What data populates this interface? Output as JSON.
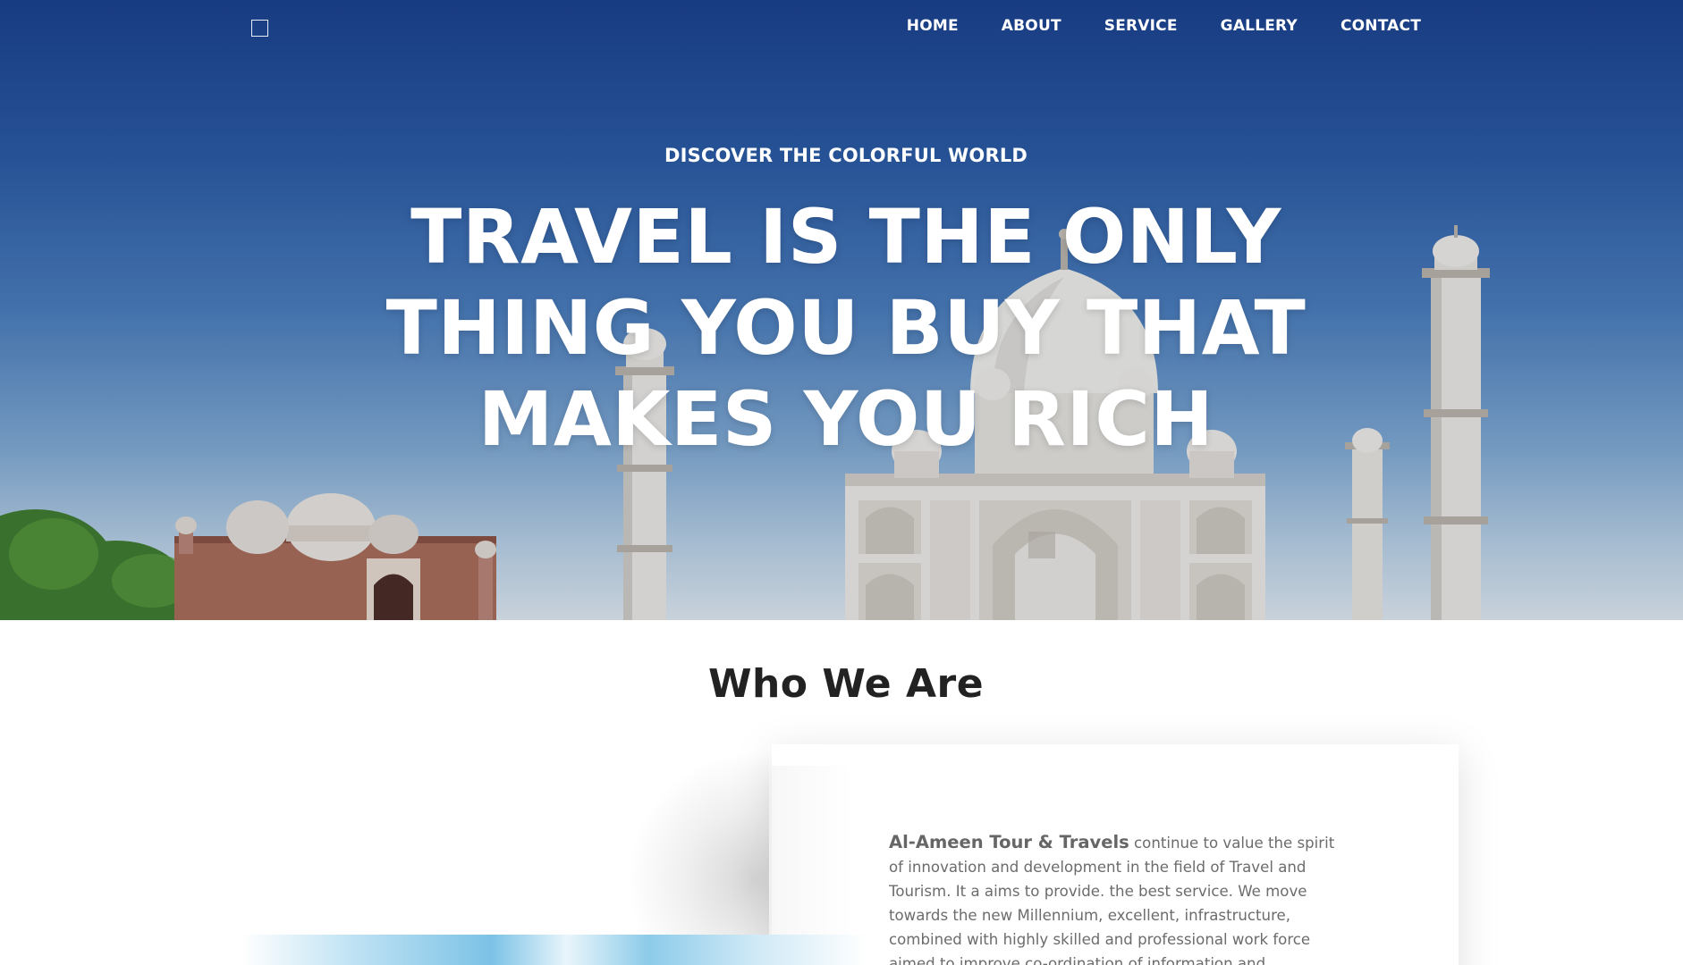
{
  "nav": {
    "items": [
      "HOME",
      "ABOUT",
      "SERVICE",
      "GALLERY",
      "CONTACT"
    ]
  },
  "hero": {
    "subtitle": "DISCOVER THE COLORFUL WORLD",
    "title_lines": [
      "TRAVEL IS THE ONLY",
      "THING YOU BUY THAT",
      "MAKES YOU RICH"
    ]
  },
  "about": {
    "heading": "Who We Are",
    "brand": "Al-Ameen Tour & Travels",
    "body": " continue to value the spirit of innovation and development in the field of Travel and Tourism. It a aims to provide. the best service. We move towards the new Millennium, excellent, infrastructure, combined with highly skilled and professional work force aimed to improve co-ordination of information and"
  },
  "colors": {
    "sky_top": "#1a3f8a",
    "heading_text": "#222222",
    "body_text": "#6c6c6c"
  }
}
